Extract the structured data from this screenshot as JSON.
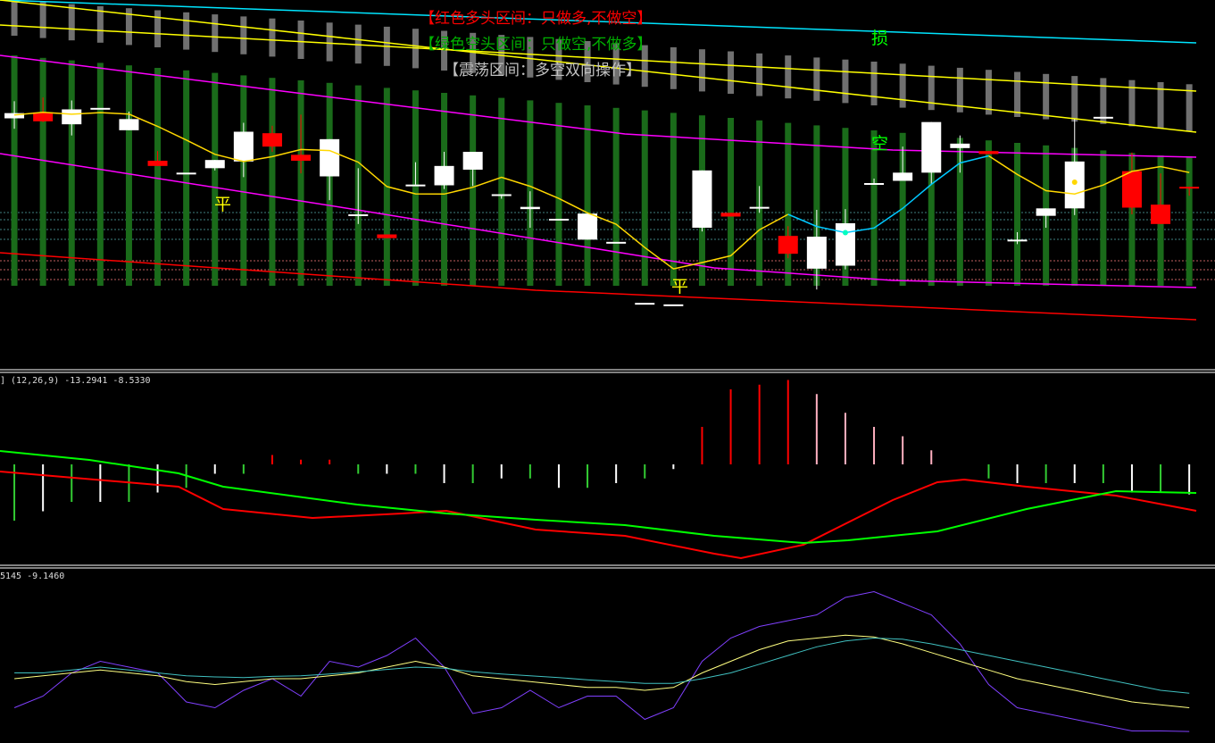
{
  "legend": {
    "bull": "【红色多头区间：只做多,不做空】",
    "bear": "【绿色空头区间：只做空,不做多】",
    "range": "【震荡区间：多空双向操作】"
  },
  "signals": {
    "flat1": "平",
    "flat2": "平",
    "stop": "损",
    "short": "空"
  },
  "indicators": {
    "macd_label": "] (12,26,9) -13.2941 -8.5330",
    "osc_label": "5145 -9.1460"
  },
  "colors": {
    "bull": "#ff0000",
    "bear": "#00b000",
    "range": "#c0c0c0",
    "up_candle": "#ffffff",
    "down_candle": "#ff0000",
    "band": "#ff00ff",
    "ma_yellow": "#ffd700",
    "ma_cyan": "#00c8ff",
    "upper_yellow": "#ffff00",
    "upper_cyan": "#00e5ff",
    "support_red": "#ff0000",
    "macd_dif": "#ff0000",
    "macd_dea": "#00ff00",
    "osc_purple": "#8040ff",
    "osc_yellow": "#ffff80",
    "osc_teal": "#40c0c0"
  },
  "chart_data": [
    {
      "type": "candlestick",
      "ohlc": [
        [
          200.5,
          202.8,
          199.1,
          201.2
        ],
        [
          201.3,
          203.3,
          200.0,
          200.1
        ],
        [
          199.7,
          202.9,
          198.2,
          201.7
        ],
        [
          201.9,
          201.9,
          201.9,
          201.9
        ],
        [
          198.9,
          201.4,
          198.9,
          200.4
        ],
        [
          194.8,
          196.1,
          194.1,
          194.1
        ],
        [
          193.2,
          193.2,
          193.2,
          193.2
        ],
        [
          193.8,
          194.9,
          193.5,
          194.9
        ],
        [
          194.7,
          199.9,
          192.6,
          198.7
        ],
        [
          198.5,
          199.5,
          196.0,
          196.7
        ],
        [
          195.6,
          201.0,
          193.1,
          194.8
        ],
        [
          192.7,
          197.7,
          189.5,
          197.7
        ],
        [
          187.4,
          193.8,
          186.3,
          187.6
        ],
        [
          184.9,
          184.9,
          184.4,
          184.4
        ],
        [
          191.6,
          194.6,
          191.6,
          191.6
        ],
        [
          191.5,
          196.0,
          191.0,
          194.1
        ],
        [
          193.6,
          196.0,
          191.4,
          196.0
        ],
        [
          190.3,
          190.3,
          189.7,
          190.3
        ],
        [
          188.3,
          190.7,
          185.8,
          188.6
        ],
        [
          187.0,
          187.0,
          187.0,
          187.0
        ],
        [
          184.2,
          187.7,
          184.2,
          187.7
        ],
        [
          183.9,
          183.9,
          183.9,
          183.9
        ],
        [
          175.7,
          175.7,
          175.7,
          175.7
        ],
        [
          175.5,
          175.5,
          175.5,
          175.5
        ],
        [
          185.8,
          193.5,
          185.3,
          193.5
        ],
        [
          187.8,
          187.8,
          187.3,
          187.3
        ],
        [
          188.4,
          191.4,
          187.8,
          188.6
        ],
        [
          184.7,
          186.0,
          181.7,
          182.3
        ],
        [
          180.3,
          188.2,
          177.5,
          184.6
        ],
        [
          180.7,
          188.3,
          180.2,
          186.4
        ],
        [
          191.8,
          192.4,
          191.7,
          191.8
        ],
        [
          192.1,
          196.7,
          192.1,
          193.2
        ],
        [
          193.2,
          200.0,
          191.7,
          200.0
        ],
        [
          196.5,
          198.2,
          193.2,
          197.1
        ],
        [
          196.1,
          196.1,
          195.7,
          195.7
        ],
        [
          184.2,
          185.2,
          183.6,
          184.2
        ],
        [
          187.4,
          188.4,
          185.8,
          188.4
        ],
        [
          188.4,
          200.4,
          187.5,
          194.7
        ],
        [
          200.7,
          200.7,
          200.7,
          200.7
        ],
        [
          193.4,
          195.9,
          187.6,
          188.5
        ],
        [
          188.9,
          193.1,
          186.3,
          186.3
        ],
        [
          191.3,
          191.3,
          190.1,
          191.1
        ]
      ],
      "series": [
        {
          "name": "",
          "values": [
            196.5,
            195.8,
            195.4,
            195.0,
            194.6,
            194.2,
            193.7,
            193.4,
            193.1,
            192.8,
            192.4,
            192.1,
            191.9,
            191.6,
            191.4,
            191.2,
            191.1,
            190.9,
            190.8,
            190.7,
            190.6,
            190.5,
            190.4,
            190.3,
            190.2,
            190.1,
            190.0,
            190.0,
            189.9,
            189.9,
            189.8,
            189.8,
            189.7,
            189.7,
            189.7,
            189.7,
            189.7,
            189.7,
            189.6,
            189.6,
            189.6,
            189.6
          ]
        },
        {
          "name": "",
          "values": [
            199.0,
            198.3,
            197.8,
            197.3,
            196.8,
            196.3,
            195.8,
            195.4,
            195.0,
            194.6,
            194.2,
            193.8,
            193.5,
            193.2,
            193.0,
            192.8,
            192.6,
            192.4,
            192.2,
            192.0,
            191.8,
            191.6,
            191.5,
            191.4,
            191.2,
            191.1,
            191.0,
            190.9,
            190.8,
            190.7,
            190.6,
            190.6,
            190.5,
            190.4,
            190.3,
            190.3,
            190.2,
            190.2,
            190.1,
            190.1,
            190.0,
            190.0
          ]
        }
      ],
      "signals": [
        "平",
        "平",
        "损",
        "空"
      ]
    },
    {
      "type": "bar",
      "title": "",
      "label": "(12,26,9) -13.2941 -8.5330",
      "values": [
        -6,
        -5,
        -4,
        -4,
        -4,
        -3,
        -2.5,
        -1,
        -1,
        1,
        0.5,
        0.5,
        -1,
        -1,
        -1,
        -2,
        -2,
        -1.5,
        -1.5,
        -2.5,
        -2.5,
        -2,
        -1.5,
        -0.5,
        4,
        8,
        8.5,
        9,
        7.5,
        5.5,
        4,
        3,
        1.5,
        0,
        -1.5,
        -2,
        -2,
        -2,
        -2,
        -3,
        -3,
        -3.2
      ]
    },
    {
      "type": "line",
      "label": "5145 -9.1460",
      "series": [
        {
          "name": "",
          "values": [
            -5,
            -3,
            1,
            3,
            2,
            1,
            -4,
            -5,
            -2,
            0,
            -3,
            3,
            2,
            4,
            7,
            2,
            -6,
            -5,
            -2,
            -5,
            -3,
            -3,
            -7,
            -5,
            3,
            7,
            9,
            10,
            11,
            14,
            15,
            13,
            11,
            6,
            -1,
            -5,
            -6,
            -7,
            -8,
            -9,
            -9,
            -9.1
          ]
        },
        {
          "name": "",
          "values": [
            0,
            0.5,
            1,
            1.5,
            1,
            0.5,
            -0.5,
            -1,
            -0.5,
            0,
            0,
            0.5,
            1,
            2,
            3,
            2,
            0.5,
            0,
            -0.5,
            -1,
            -1.5,
            -1.5,
            -2,
            -1.5,
            1,
            3,
            5,
            6.5,
            7,
            7.5,
            7.2,
            6,
            4.5,
            3,
            1.5,
            0,
            -1,
            -2,
            -3,
            -4,
            -4.5,
            -5
          ]
        },
        {
          "name": "",
          "values": [
            1,
            1,
            1.5,
            2,
            1.5,
            1,
            0.5,
            0.3,
            0.2,
            0.4,
            0.5,
            0.8,
            1.2,
            1.6,
            2,
            1.8,
            1.2,
            0.8,
            0.5,
            0.2,
            -0.2,
            -0.5,
            -0.8,
            -0.8,
            0,
            1,
            2.5,
            4,
            5.5,
            6.5,
            7,
            6.8,
            6,
            5,
            4,
            3,
            2,
            1,
            0,
            -1,
            -2,
            -2.5
          ]
        }
      ]
    }
  ]
}
